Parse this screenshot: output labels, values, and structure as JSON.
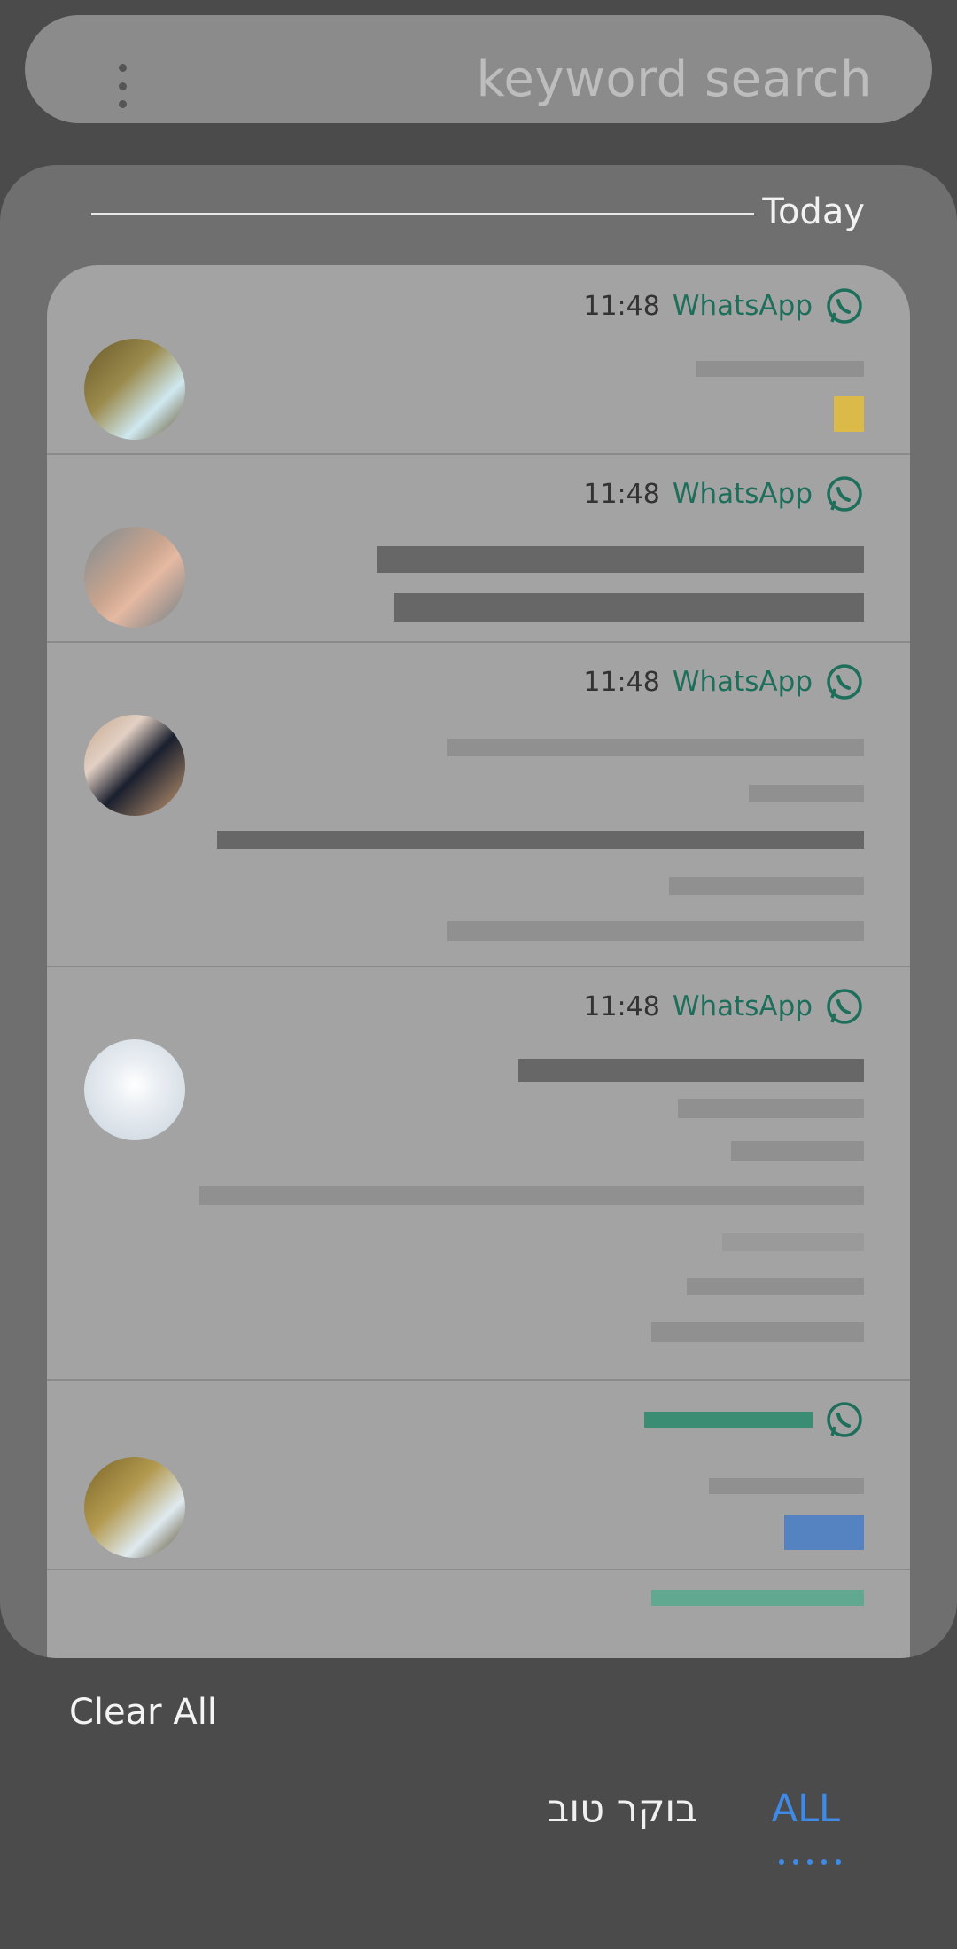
{
  "search": {
    "placeholder": "keyword search"
  },
  "section": {
    "label": "Today"
  },
  "notifications": [
    {
      "time": "11:48",
      "app": "WhatsApp"
    },
    {
      "time": "11:48",
      "app": "WhatsApp"
    },
    {
      "time": "11:48",
      "app": "WhatsApp"
    },
    {
      "time": "11:48",
      "app": "WhatsApp"
    }
  ],
  "footer": {
    "clear_all": "Clear All",
    "tabs": [
      {
        "label": "בוקר טוב"
      },
      {
        "label": "ALL"
      }
    ]
  },
  "colors": {
    "accent": "#3f8ae6",
    "whatsapp": "#1d6e5a"
  },
  "icons": {
    "menu": "more-vert-icon",
    "app": "whatsapp-icon"
  }
}
